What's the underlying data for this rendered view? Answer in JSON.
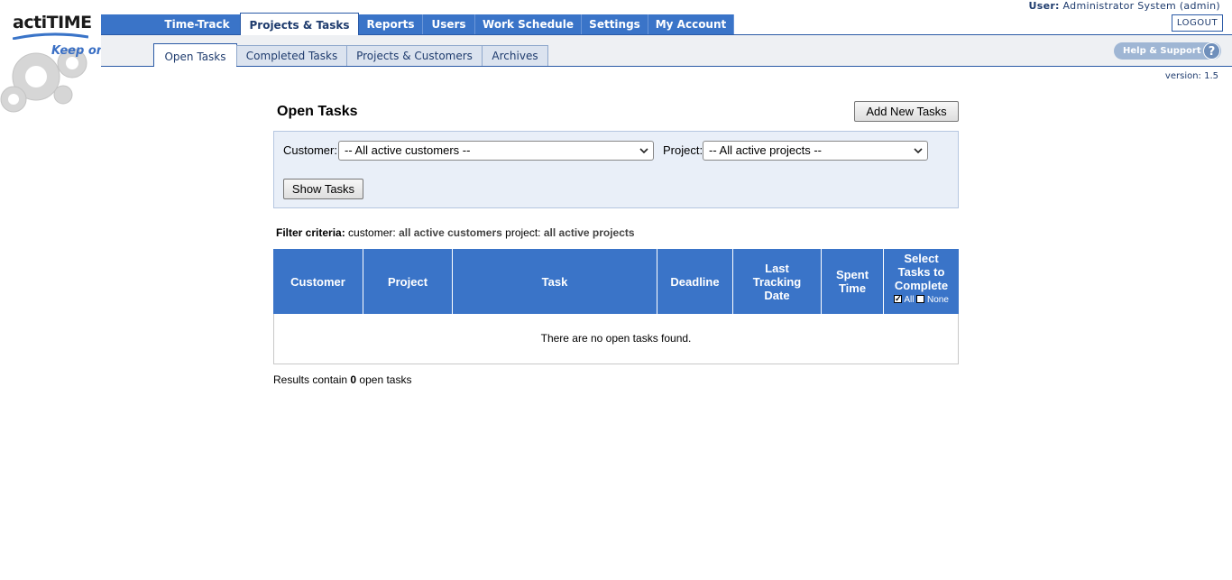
{
  "app": {
    "logo_text": "actiTIME",
    "tagline": "Keep on trackin'",
    "version": "version: 1.5"
  },
  "user": {
    "label": "User:",
    "name": "Administrator System (admin)",
    "logout": "LOGOUT",
    "help": "Help & Support"
  },
  "main_tabs": [
    {
      "label": "Time-Track"
    },
    {
      "label": "Projects & Tasks",
      "active": true
    },
    {
      "label": "Reports"
    },
    {
      "label": "Users"
    },
    {
      "label": "Work Schedule"
    },
    {
      "label": "Settings"
    },
    {
      "label": "My Account"
    }
  ],
  "sub_tabs": [
    {
      "label": "Open Tasks",
      "active": true
    },
    {
      "label": "Completed Tasks"
    },
    {
      "label": "Projects & Customers"
    },
    {
      "label": "Archives"
    }
  ],
  "page": {
    "title": "Open Tasks",
    "add_button": "Add New Tasks"
  },
  "filter": {
    "customer_label": "Customer:",
    "customer_value": "-- All active customers --",
    "project_label": "Project:",
    "project_value": "-- All active projects --",
    "show_button": "Show Tasks",
    "criteria_label": "Filter criteria:",
    "criteria_customer_key": "customer:",
    "criteria_customer_val": "all active customers",
    "criteria_project_key": "project:",
    "criteria_project_val": "all active projects"
  },
  "table": {
    "headers": [
      "Customer",
      "Project",
      "Task",
      "Deadline",
      "Last Tracking Date",
      "Spent Time",
      "Select Tasks to Complete"
    ],
    "select_all": "All",
    "select_none": "None",
    "empty_message": "There are no open tasks found."
  },
  "results": {
    "prefix": "Results contain",
    "count": "0",
    "suffix": "open tasks"
  },
  "colors": {
    "nav_blue": "#3a74c8",
    "dark_blue": "#1f3c6e",
    "filter_bg": "#e9eff8"
  }
}
